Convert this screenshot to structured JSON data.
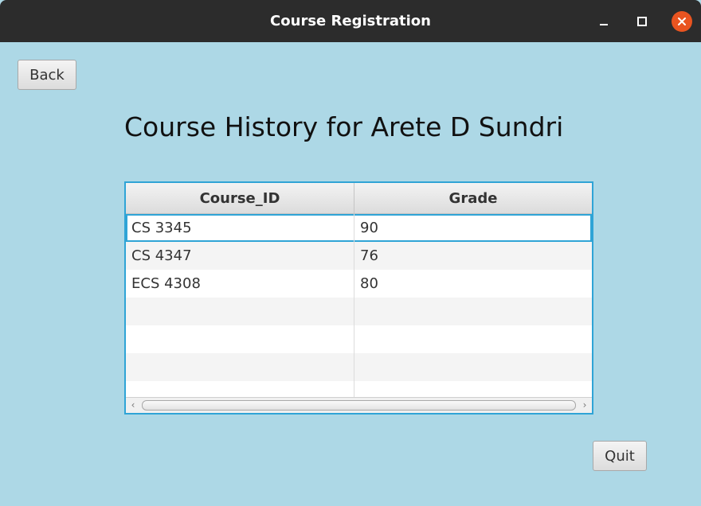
{
  "window": {
    "title": "Course Registration",
    "close_color": "#e95420",
    "background": "#add8e6"
  },
  "toolbar": {
    "back_label": "Back",
    "quit_label": "Quit"
  },
  "page": {
    "heading": "Course History for Arete D Sundri"
  },
  "table": {
    "columns": [
      "Course_ID",
      "Grade"
    ],
    "rows": [
      {
        "course_id": "CS 3345",
        "grade": "90"
      },
      {
        "course_id": "CS 4347",
        "grade": "76"
      },
      {
        "course_id": "ECS 4308",
        "grade": "80"
      },
      {
        "course_id": "",
        "grade": ""
      },
      {
        "course_id": "",
        "grade": ""
      },
      {
        "course_id": "",
        "grade": ""
      },
      {
        "course_id": "",
        "grade": ""
      }
    ]
  },
  "icons": {
    "minimize": "minimize-icon",
    "maximize": "maximize-icon",
    "close": "close-icon",
    "scroll_left": "chevron-left-icon",
    "scroll_right": "chevron-right-icon"
  }
}
